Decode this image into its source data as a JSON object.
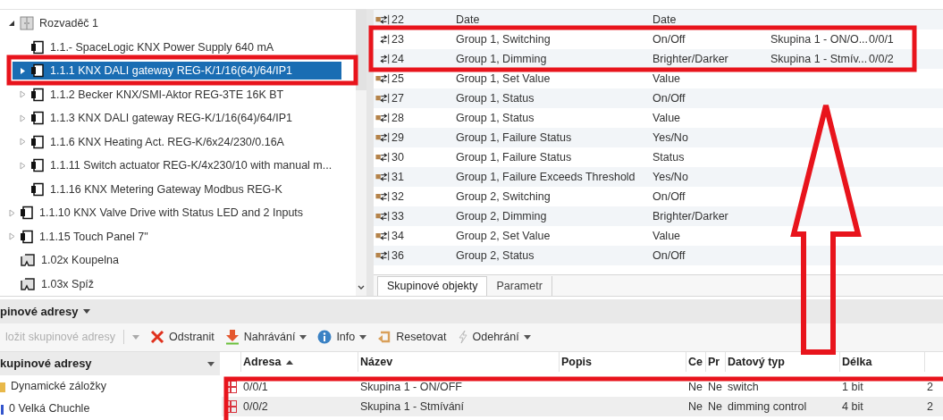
{
  "device_tree": {
    "items": [
      {
        "label": "Rozvaděč 1",
        "kind": "cabinet",
        "expandable": true,
        "selected": false,
        "children": [
          {
            "label": "1.1.- SpaceLogic KNX Power Supply 640 mA",
            "kind": "device",
            "expandable": false,
            "selected": false
          },
          {
            "label": "1.1.1 KNX DALI gateway REG-K/1/16(64)/64/IP1",
            "kind": "device",
            "expandable": true,
            "selected": true
          },
          {
            "label": "1.1.2 Becker KNX/SMI-Aktor REG-3TE 16K BT",
            "kind": "device",
            "expandable": true,
            "selected": false
          },
          {
            "label": "1.1.3 KNX DALI gateway REG-K/1/16(64)/64/IP1",
            "kind": "device",
            "expandable": true,
            "selected": false
          },
          {
            "label": "1.1.6 KNX Heating Act. REG-K/6x24/230/0.16A",
            "kind": "device",
            "expandable": true,
            "selected": false
          },
          {
            "label": "1.1.11 Switch actuator REG-K/4x230/10 with manual m...",
            "kind": "device",
            "expandable": true,
            "selected": false
          },
          {
            "label": "1.1.16 KNX Metering Gateway Modbus REG-K",
            "kind": "device",
            "expandable": false,
            "selected": false
          }
        ]
      },
      {
        "label": "1.1.10 KNX Valve Drive with Status LED and 2 Inputs",
        "kind": "device",
        "expandable": true,
        "selected": false
      },
      {
        "label": "1.1.15 Touch Panel 7\"",
        "kind": "device",
        "expandable": true,
        "selected": false
      },
      {
        "label": "1.02x Koupelna",
        "kind": "room",
        "expandable": false,
        "selected": false
      },
      {
        "label": "1.03x Spíž",
        "kind": "room",
        "expandable": false,
        "selected": false
      }
    ]
  },
  "objects_table": {
    "rows": [
      {
        "number": "22",
        "name": "Date",
        "function": "Date",
        "linked": false
      },
      {
        "number": "23",
        "name": "Group 1, Switching",
        "function": "On/Off",
        "linked": true,
        "group_address_name": "Skupina 1 - ON/O...",
        "group_address": "0/0/1"
      },
      {
        "number": "24",
        "name": "Group 1, Dimming",
        "function": "Brighter/Darker",
        "linked": true,
        "group_address_name": "Skupina 1 - Stmív...",
        "group_address": "0/0/2"
      },
      {
        "number": "25",
        "name": "Group 1, Set Value",
        "function": "Value",
        "linked": false
      },
      {
        "number": "27",
        "name": "Group 1, Status",
        "function": "On/Off",
        "linked": false
      },
      {
        "number": "28",
        "name": "Group 1, Status",
        "function": "Value",
        "linked": false
      },
      {
        "number": "29",
        "name": "Group 1, Failure Status",
        "function": "Yes/No",
        "linked": false
      },
      {
        "number": "30",
        "name": "Group 1, Failure Status",
        "function": "Status",
        "linked": false
      },
      {
        "number": "31",
        "name": "Group 1, Failure Exceeds Threshold",
        "function": "Yes/No",
        "linked": false
      },
      {
        "number": "32",
        "name": "Group 2, Switching",
        "function": "On/Off",
        "linked": false
      },
      {
        "number": "33",
        "name": "Group 2, Dimming",
        "function": "Brighter/Darker",
        "linked": false
      },
      {
        "number": "34",
        "name": "Group 2, Set Value",
        "function": "Value",
        "linked": false
      },
      {
        "number": "36",
        "name": "Group 2, Status",
        "function": "On/Off",
        "linked": false
      }
    ]
  },
  "object_tabs": [
    {
      "label": "Skupinové objekty",
      "selected": true
    },
    {
      "label": "Parametr",
      "selected": false
    }
  ],
  "group_addresses": {
    "title": "pinové adresy",
    "toolbar": [
      {
        "kind": "insert",
        "label": "ložit skupinové adresy",
        "disabled": true,
        "dropdown": true
      },
      {
        "kind": "delete",
        "label": "Odstranit",
        "disabled": false,
        "dropdown": false
      },
      {
        "kind": "download",
        "label": "Nahrávání",
        "disabled": false,
        "dropdown": true
      },
      {
        "kind": "info",
        "label": "Info",
        "disabled": false,
        "dropdown": true
      },
      {
        "kind": "reset",
        "label": "Resetovat",
        "disabled": false,
        "dropdown": false
      },
      {
        "kind": "unload",
        "label": "Odehrání",
        "disabled": false,
        "dropdown": true
      }
    ],
    "tree": {
      "header": "kupinové adresy",
      "items": [
        {
          "label": "Dynamické záložky",
          "kind": "bookmarks"
        },
        {
          "label": "0 Velká Chuchle",
          "kind": "main_group"
        }
      ]
    },
    "table": {
      "columns": [
        "Adresa",
        "Název",
        "Popis",
        "Ce",
        "Pr",
        "Datový typ",
        "Délka"
      ],
      "rows": [
        {
          "address": "0/0/1",
          "name": "Skupina 1 - ON/OFF",
          "ce": "Ne",
          "pr": "Ne",
          "data_type": "switch",
          "length": "1 bit",
          "column_9": "2"
        },
        {
          "address": "0/0/2",
          "name": "Skupina 1 - Stmívání",
          "ce": "Ne",
          "pr": "Ne",
          "data_type": "dimming control",
          "length": "4 bit",
          "column_9": "2"
        }
      ]
    }
  }
}
